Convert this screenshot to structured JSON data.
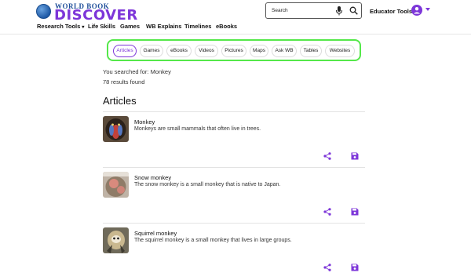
{
  "brand": {
    "line1": "WORLD BOOK",
    "line2": "DISCOVER",
    "accent": "#7d36d9",
    "navy": "#1f4f9a"
  },
  "nav": {
    "items": [
      "Research Tools",
      "Life Skills",
      "Games",
      "WB Explains",
      "Timelines",
      "eBooks"
    ]
  },
  "search": {
    "placeholder": "Search"
  },
  "header_right": {
    "educator_tools": "Educator Tools"
  },
  "filters": [
    "Articles",
    "Games",
    "eBooks",
    "Videos",
    "Pictures",
    "Maps",
    "Ask WB",
    "Tables",
    "Websites"
  ],
  "active_filter": "Articles",
  "results_info": {
    "searched_for": "You searched for: Monkey",
    "count": "78 results found"
  },
  "section_title": "Articles",
  "results": [
    {
      "title": "Monkey",
      "description": "Monkeys are small mammals that often live in trees."
    },
    {
      "title": "Snow monkey",
      "description": "The snow monkey is a small monkey that is native to Japan."
    },
    {
      "title": "Squirrel monkey",
      "description": "The squirrel monkey is a small monkey that lives in large groups."
    }
  ],
  "highlight_color": "#55e84a"
}
